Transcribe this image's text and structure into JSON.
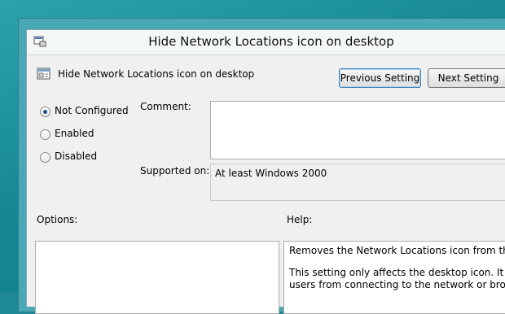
{
  "window": {
    "title": "Hide Network Locations icon on desktop"
  },
  "policy": {
    "name": "Hide Network Locations icon on desktop"
  },
  "buttons": {
    "previous": "Previous Setting",
    "next": "Next Setting"
  },
  "state_options": [
    {
      "label": "Not Configured",
      "selected": true
    },
    {
      "label": "Enabled",
      "selected": false
    },
    {
      "label": "Disabled",
      "selected": false
    }
  ],
  "comment": {
    "label": "Comment:",
    "value": ""
  },
  "supported_on": {
    "label": "Supported on:",
    "value": "At least Windows 2000"
  },
  "sections": {
    "options_label": "Options:",
    "help_label": "Help:"
  },
  "help": {
    "line1": "Removes the Network Locations icon from the des",
    "line2": "This setting only affects the desktop icon. It does n",
    "line3": "users from connecting to the network or browsing"
  },
  "colors": {
    "desktop": "#178893",
    "dialog_bg": "#f0f0f0",
    "radio_dot": "#1c4f8c"
  },
  "icons": {
    "title": "policy-settings-icon",
    "policy": "policy-document-icon"
  }
}
